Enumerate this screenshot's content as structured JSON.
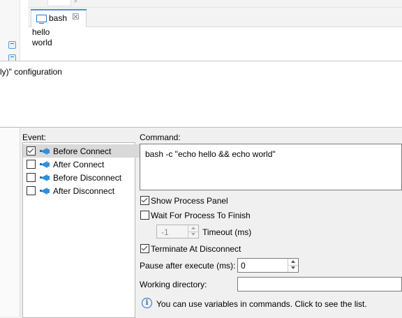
{
  "terminal": {
    "tab_label": "bash",
    "tab_close_glyph": "☒",
    "output_lines": [
      "hello",
      "world"
    ]
  },
  "description": {
    "text": "ly)\" configuration"
  },
  "events": {
    "label": "Event:",
    "items": [
      {
        "label": "Before Connect",
        "checked": true,
        "selected": true,
        "icon": "megaphone-icon"
      },
      {
        "label": "After Connect",
        "checked": false,
        "selected": false,
        "icon": "megaphone-icon"
      },
      {
        "label": "Before Disconnect",
        "checked": false,
        "selected": false,
        "icon": "megaphone-icon"
      },
      {
        "label": "After Disconnect",
        "checked": false,
        "selected": false,
        "icon": "megaphone-icon"
      }
    ]
  },
  "command": {
    "label": "Command:",
    "value": "bash -c \"echo hello && echo world\""
  },
  "options": {
    "show_process_panel": {
      "label": "Show Process Panel",
      "checked": true
    },
    "wait_for_process": {
      "label": "Wait For Process To Finish",
      "checked": false
    },
    "timeout": {
      "value": "-1",
      "label": "Timeout (ms)",
      "disabled": true
    },
    "terminate_at_disconnect": {
      "label": "Terminate At Disconnect",
      "checked": true
    },
    "pause_after_execute": {
      "label": "Pause after execute (ms):",
      "value": "0"
    },
    "working_directory": {
      "label": "Working directory:",
      "value": ""
    }
  },
  "info": {
    "icon": "info-icon",
    "glyph": "i",
    "text": "You can use variables in commands. Click to see the list."
  },
  "colors": {
    "accent": "#4a8fd8",
    "megaphone": "#2f8fdc",
    "info": "#1f6fc5",
    "selection": "#d9d9d9"
  }
}
